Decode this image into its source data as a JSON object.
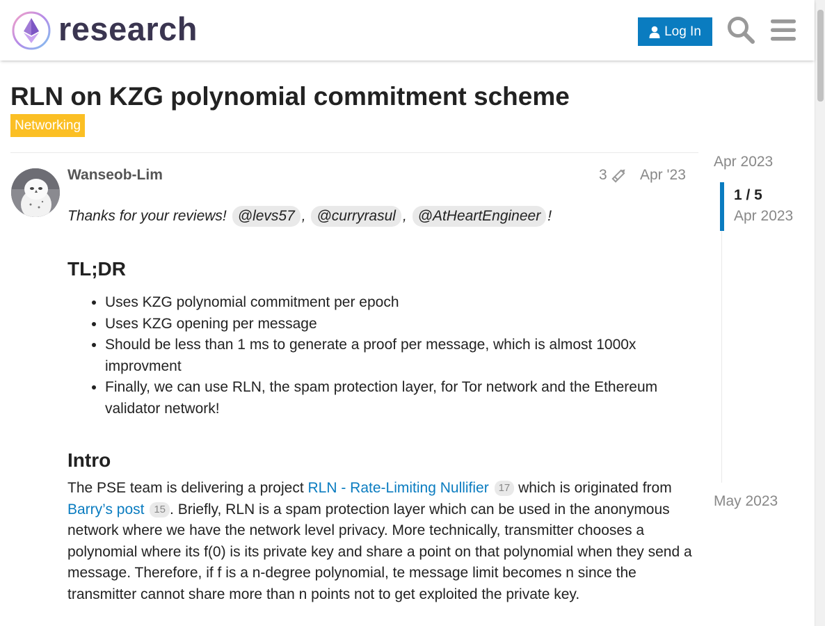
{
  "header": {
    "site_name": "research",
    "login_label": "Log In",
    "icons": {
      "logo": "ethereum-research-logo",
      "user": "user-icon",
      "search": "search-icon",
      "menu": "hamburger-menu-icon"
    },
    "accent_color": "#0a7cc0"
  },
  "topic": {
    "title": "RLN on KZG polynomial commitment scheme",
    "category": "Networking",
    "category_color": "#fbbf24"
  },
  "post": {
    "username": "Wanseob-Lim",
    "edit_count": "3",
    "date": "Apr '23",
    "thanks_text": "Thanks for your reviews!",
    "mentions": [
      "@levs57",
      "@curryrasul",
      "@AtHeartEngineer"
    ],
    "thanks_end": "!",
    "tldr_heading": "TL;DR",
    "tldr_items": [
      "Uses KZG polynomial commitment per epoch",
      "Uses KZG opening per message",
      "Should be less than 1 ms to generate a proof per message, which is almost 1000x improvment",
      "Finally, we can use RLN, the spam protection layer, for Tor network and the Ethereum validator network!"
    ],
    "intro_heading": "Intro",
    "intro": {
      "text_1": "The PSE team is delivering a project ",
      "link_1": "RLN - Rate-Limiting Nullifier",
      "link_1_clicks": "17",
      "text_2": " which is originated from ",
      "link_2": "Barry’s post",
      "link_2_clicks": "15",
      "text_3": ". Briefly, RLN is a spam protection layer which can be used in the anonymous network where we have the network level privacy. More technically, transmitter chooses a polynomial where its f(0) is its private key and share a point on that polynomial when they send a message. Therefore, if f is a n-degree polynomial, te message limit becomes n since the transmitter cannot share more than n points not to get exploited the private key."
    }
  },
  "timeline": {
    "start": "Apr 2023",
    "position": "1 / 5",
    "position_date": "Apr 2023",
    "end": "May 2023"
  }
}
